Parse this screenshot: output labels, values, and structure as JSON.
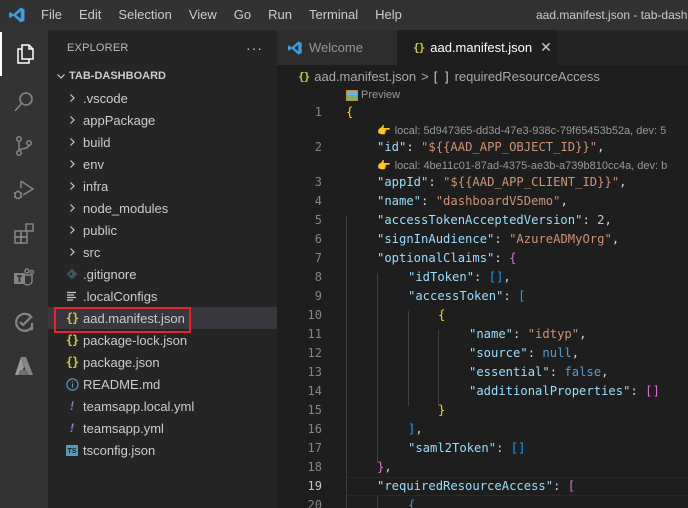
{
  "titlebar": {
    "menu": [
      "File",
      "Edit",
      "Selection",
      "View",
      "Go",
      "Run",
      "Terminal",
      "Help"
    ],
    "window_title": "aad.manifest.json - tab-dashboard"
  },
  "activitybar": {
    "items": [
      "explorer",
      "search",
      "source-control",
      "run-and-debug",
      "extensions",
      "teams-toolkit",
      "testing",
      "azure"
    ]
  },
  "sidebar": {
    "title": "EXPLORER",
    "more": "···",
    "folder": "TAB-DASHBOARD",
    "folders": [
      ".vscode",
      "appPackage",
      "build",
      "env",
      "infra",
      "node_modules",
      "public",
      "src"
    ],
    "files": [
      {
        "name": ".gitignore",
        "icon": "git-icon"
      },
      {
        "name": ".localConfigs",
        "icon": "text-file-icon"
      },
      {
        "name": "aad.manifest.json",
        "icon": "json-icon",
        "highlighted": true
      },
      {
        "name": "package-lock.json",
        "icon": "json-icon"
      },
      {
        "name": "package.json",
        "icon": "json-icon"
      },
      {
        "name": "README.md",
        "icon": "info-icon"
      },
      {
        "name": "teamsapp.local.yml",
        "icon": "yaml-icon"
      },
      {
        "name": "teamsapp.yml",
        "icon": "yaml-icon"
      },
      {
        "name": "tsconfig.json",
        "icon": "typescript-icon"
      }
    ],
    "highlight_color": "#e8212b"
  },
  "tabs": [
    {
      "label": "Welcome",
      "active": false
    },
    {
      "label": "aad.manifest.json",
      "active": true,
      "close": "✕"
    }
  ],
  "breadcrumb": {
    "file": "aad.manifest.json",
    "separator": ">",
    "symbol_icon": "[ ]",
    "symbol": "requiredResourceAccess"
  },
  "editor": {
    "preview_label": "Preview",
    "lens_1": "local: 5d947365-dd3d-47e3-938c-79f65453b52a, dev: 5",
    "lens_2": "local: 4be11c01-87ad-4375-ae3b-a739b810cc4a, dev: b",
    "current_line": 19,
    "line_numbers": [
      "1",
      "2",
      "3",
      "4",
      "5",
      "6",
      "7",
      "8",
      "9",
      "10",
      "11",
      "12",
      "13",
      "14",
      "15",
      "16",
      "17",
      "18",
      "19",
      "20"
    ],
    "code": {
      "l1": "{",
      "l2_key": "\"id\"",
      "l2_val": "\"${{AAD_APP_OBJECT_ID}}\"",
      "l3_key": "\"appId\"",
      "l3_val": "\"${{AAD_APP_CLIENT_ID}}\"",
      "l4_key": "\"name\"",
      "l4_val": "\"dashboardV5Demo\"",
      "l5_key": "\"accessTokenAcceptedVersion\"",
      "l5_val": "2",
      "l6_key": "\"signInAudience\"",
      "l6_val": "\"AzureADMyOrg\"",
      "l7_key": "\"optionalClaims\"",
      "l7_open": "{",
      "l8_key": "\"idToken\"",
      "l8_val": "[]",
      "l9_key": "\"accessToken\"",
      "l9_open": "[",
      "l10": "{",
      "l11_key": "\"name\"",
      "l11_val": "\"idtyp\"",
      "l12_key": "\"source\"",
      "l12_val": "null",
      "l13_key": "\"essential\"",
      "l13_val": "false",
      "l14_key": "\"additionalProperties\"",
      "l14_val": "[]",
      "l15": "}",
      "l16": "]",
      "l17_key": "\"saml2Token\"",
      "l17_val": "[]",
      "l18": "}",
      "l19_key": "\"requiredResourceAccess\"",
      "l19_open": "[",
      "l20": "{"
    }
  }
}
